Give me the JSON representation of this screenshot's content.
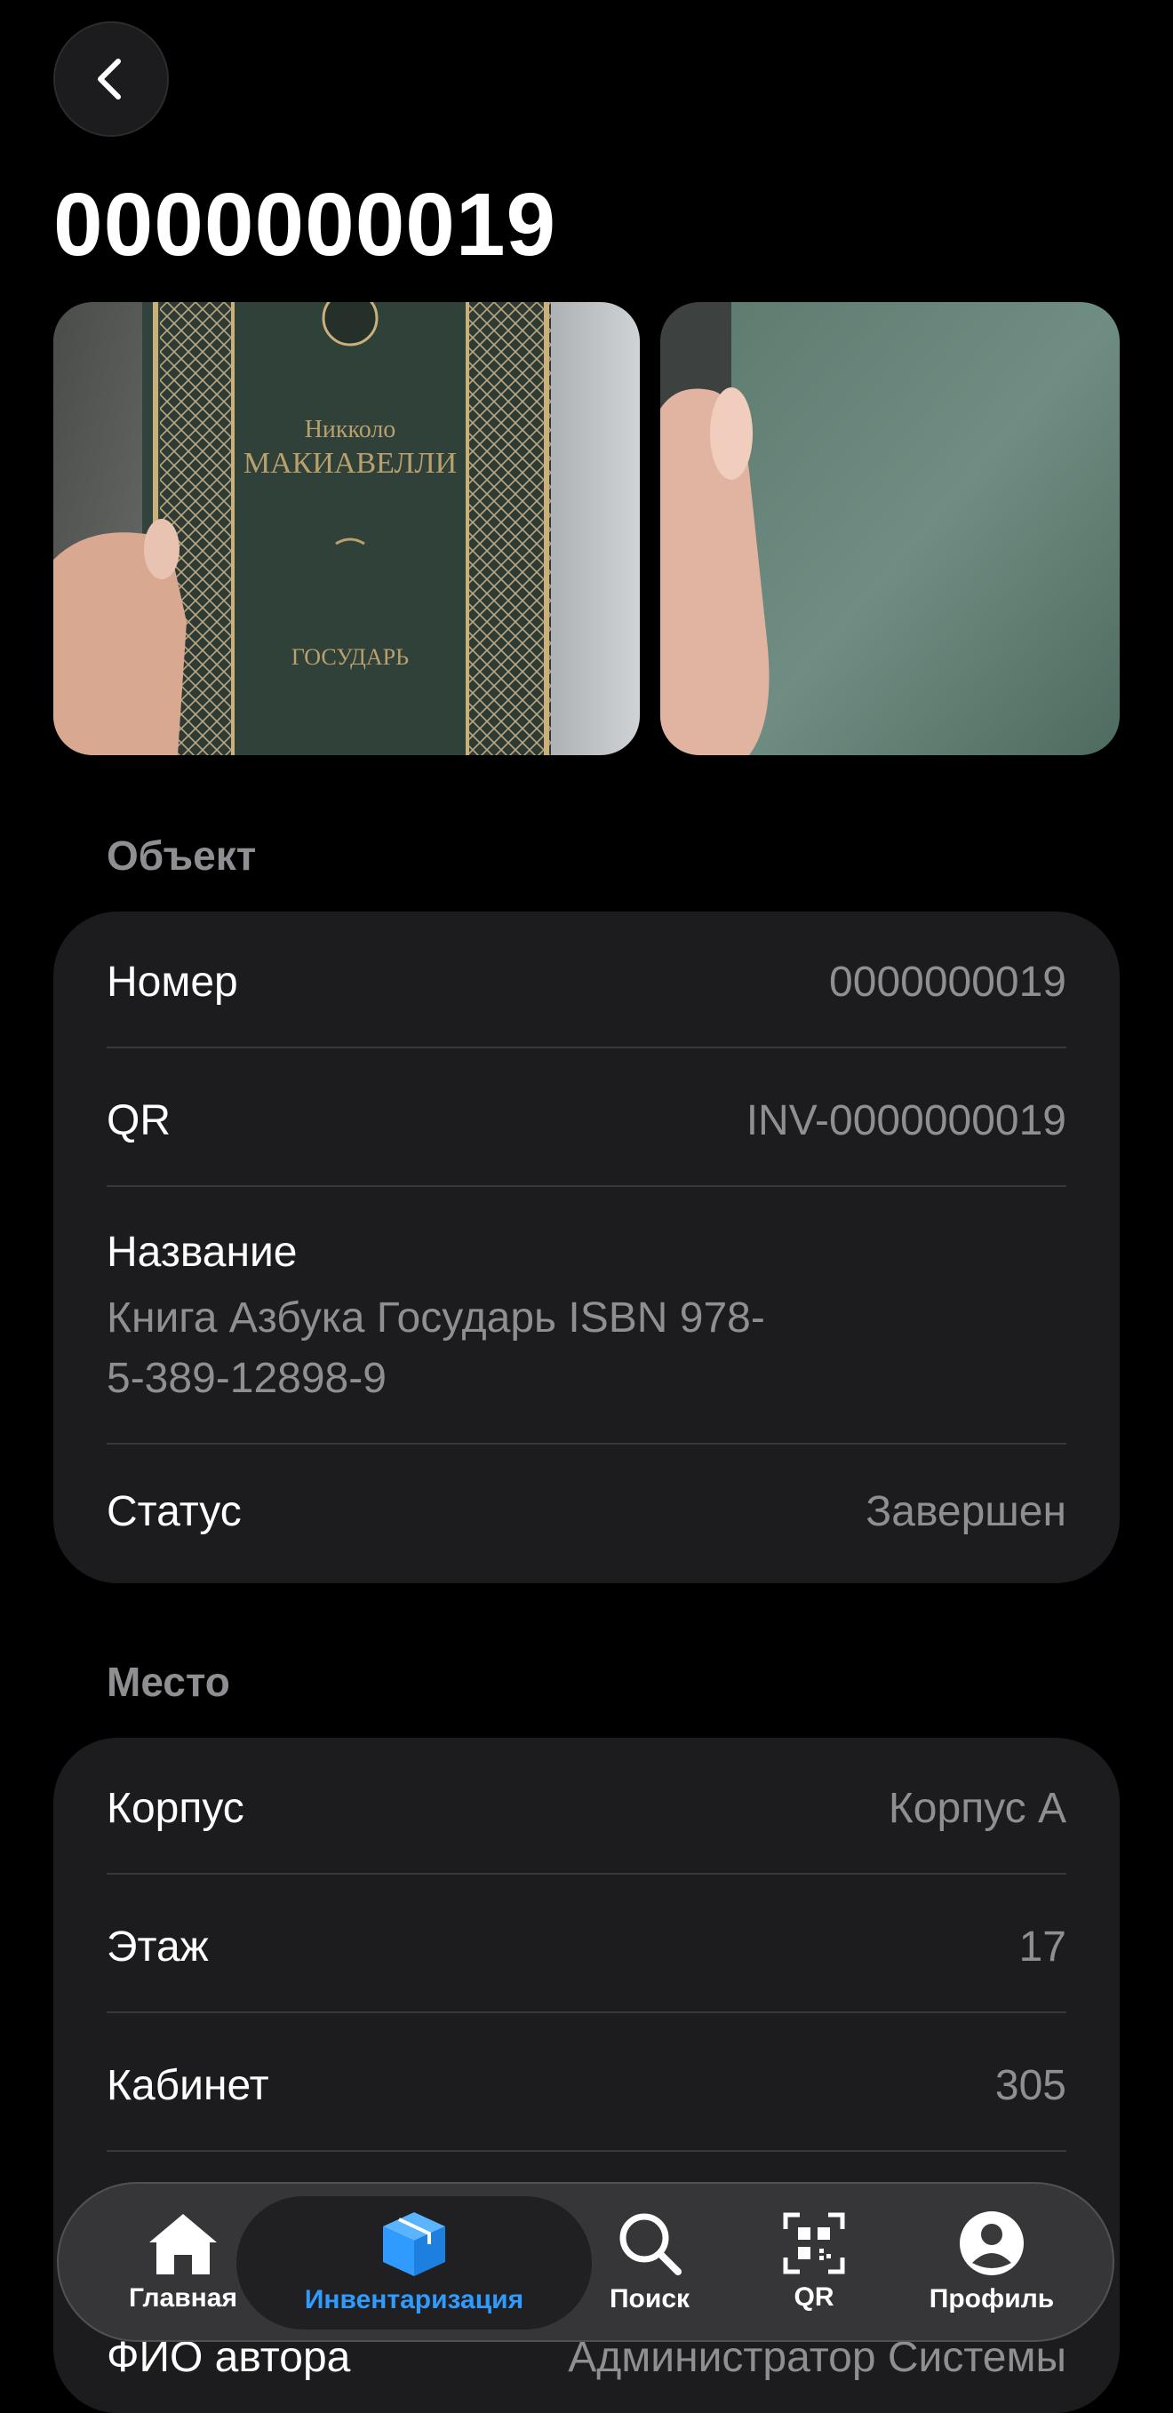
{
  "header": {
    "back_icon": "chevron-left-icon",
    "title": "0000000019"
  },
  "photos": [
    {
      "alt": "book-front",
      "cover_author_first": "Никколо",
      "cover_author_last": "МАКИАВЕЛЛИ",
      "cover_title": "ГОСУДАРЬ"
    },
    {
      "alt": "book-back"
    }
  ],
  "object_section": {
    "header": "Объект",
    "rows": [
      {
        "label": "Номер",
        "value": "0000000019"
      },
      {
        "label": "QR",
        "value": "INV-0000000019"
      },
      {
        "label": "Название",
        "value": "Книга Азбука Государь ISBN 978-5-389-12898-9"
      },
      {
        "label": "Статус",
        "value": "Завершен"
      }
    ]
  },
  "place_section": {
    "header": "Место",
    "rows": [
      {
        "label": "Корпус",
        "value": "Корпус А"
      },
      {
        "label": "Этаж",
        "value": "17"
      },
      {
        "label": "Кабинет",
        "value": "305"
      },
      {
        "label": "ФИО автора",
        "value": "Администратор Системы"
      }
    ]
  },
  "tabbar": {
    "active": "Инвентаризация",
    "accent_color": "#2f9bff",
    "items": [
      {
        "label": "Главная",
        "icon": "house-icon"
      },
      {
        "label": "Инвентаризация",
        "icon": "box-icon"
      },
      {
        "label": "Поиск",
        "icon": "magnifier-icon"
      },
      {
        "label": "QR",
        "icon": "qr-icon"
      },
      {
        "label": "Профиль",
        "icon": "person-icon"
      }
    ]
  }
}
